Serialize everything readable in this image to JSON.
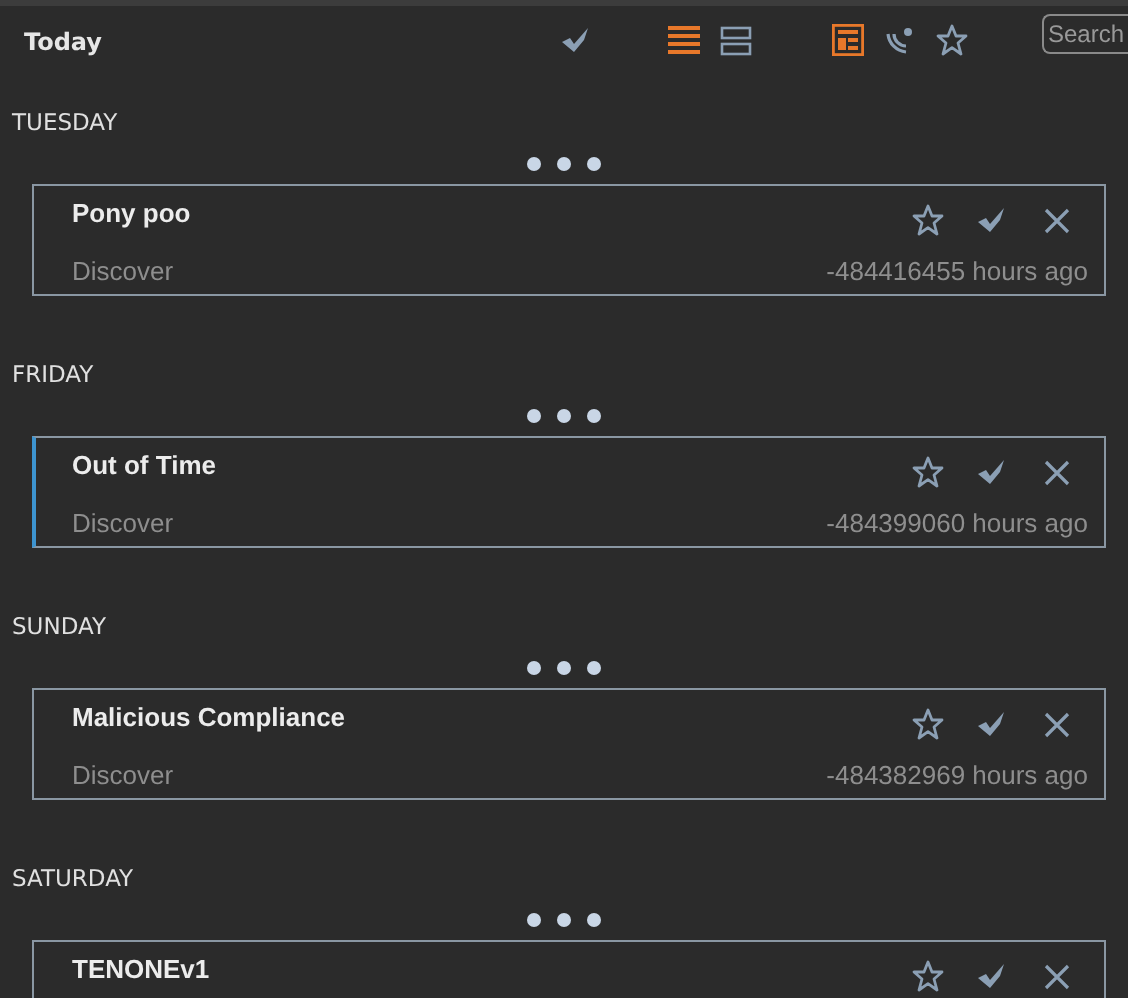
{
  "toolbar": {
    "title": "Today",
    "actions": [
      {
        "kind": "check"
      }
    ],
    "view_modes": [
      {
        "kind": "list",
        "selected": true
      },
      {
        "kind": "split",
        "selected": false
      }
    ],
    "filters": [
      {
        "kind": "layout",
        "selected": true
      },
      {
        "kind": "feed",
        "selected": false
      },
      {
        "kind": "star",
        "selected": false
      }
    ],
    "search": {
      "placeholder": "Search"
    }
  },
  "groups": [
    {
      "day": "TUESDAY",
      "entries": [
        {
          "title": "Pony poo",
          "source": "Discover",
          "age": "-484416455 hours ago",
          "selected": false
        }
      ]
    },
    {
      "day": "FRIDAY",
      "entries": [
        {
          "title": "Out of Time",
          "source": "Discover",
          "age": "-484399060 hours ago",
          "selected": true
        }
      ]
    },
    {
      "day": "SUNDAY",
      "entries": [
        {
          "title": "Malicious Compliance",
          "source": "Discover",
          "age": "-484382969 hours ago",
          "selected": false
        }
      ]
    },
    {
      "day": "SATURDAY",
      "entries": [
        {
          "title": "TENONEv1",
          "selected": false
        }
      ]
    }
  ]
}
